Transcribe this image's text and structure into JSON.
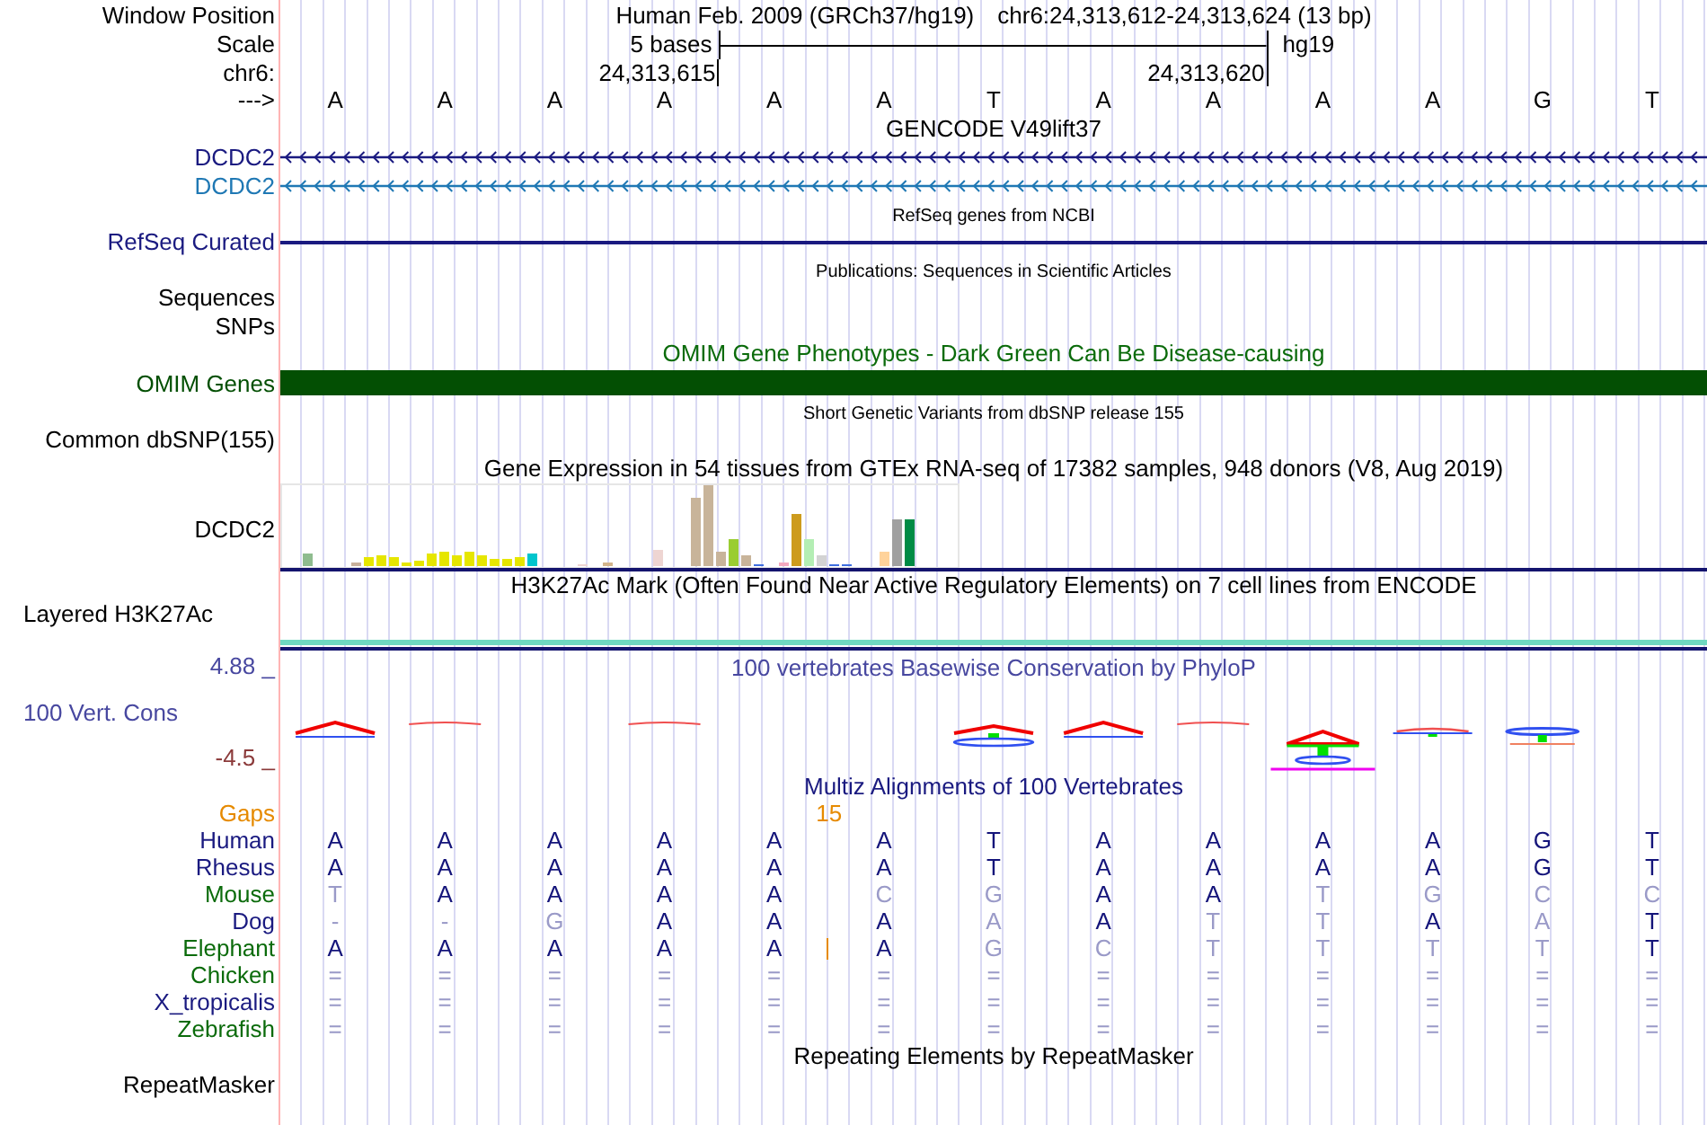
{
  "header": {
    "window_position_label": "Window Position",
    "assembly": "Human Feb. 2009 (GRCh37/hg19)",
    "position": "chr6:24,313,612-24,313,624 (13 bp)",
    "scale_label": "Scale",
    "scale_text": "5 bases",
    "scale_db": "hg19",
    "chrom_label": "chr6:",
    "coord_start": "24,313,615",
    "coord_end": "24,313,620",
    "strand_label": "--->",
    "bases": [
      "A",
      "A",
      "A",
      "A",
      "A",
      "A",
      "T",
      "A",
      "A",
      "A",
      "A",
      "G",
      "T"
    ]
  },
  "tracks": [
    {
      "kind": "title",
      "text": "GENCODE V49lift37"
    },
    {
      "kind": "gene",
      "label": "DCDC2",
      "color": "#1a1a80"
    },
    {
      "kind": "gene",
      "label": "DCDC2",
      "color": "#1f78b4"
    },
    {
      "kind": "note",
      "text": "RefSeq genes from NCBI"
    },
    {
      "kind": "line",
      "label": "RefSeq Curated",
      "color": "#1a1a80"
    },
    {
      "kind": "note",
      "text": "Publications: Sequences in Scientific Articles"
    },
    {
      "kind": "label",
      "label": "Sequences"
    },
    {
      "kind": "label",
      "label": "SNPs"
    },
    {
      "kind": "title",
      "text": "OMIM Gene Phenotypes - Dark Green Can Be Disease-causing",
      "color": "#0b6b0b"
    },
    {
      "kind": "bar",
      "label": "OMIM Genes",
      "color": "#034f03"
    },
    {
      "kind": "note",
      "text": "Short Genetic Variants from dbSNP release 155"
    },
    {
      "kind": "label",
      "label": "Common dbSNP(155)"
    },
    {
      "kind": "title",
      "text": "Gene Expression in 54 tissues from GTEx RNA-seq of 17382 samples, 948 donors (V8, Aug 2019)"
    },
    {
      "kind": "expression",
      "label": "DCDC2"
    },
    {
      "kind": "title",
      "text": "H3K27Ac Mark (Often Found Near Active Regulatory Elements) on 7 cell lines from ENCODE"
    },
    {
      "kind": "layered",
      "label": "Layered H3K27Ac"
    },
    {
      "kind": "conservation",
      "title": "100 vertebrates Basewise Conservation by PhyloP",
      "label": "100 Vert. Cons",
      "max": "4.88 _",
      "min": "-4.5 _"
    },
    {
      "kind": "title",
      "text": "Multiz Alignments of 100 Vertebrates",
      "color": "#1a1a80"
    },
    {
      "kind": "gaps",
      "label": "Gaps",
      "value": "15"
    },
    {
      "kind": "species",
      "label": "Human",
      "color": "#1a1a80",
      "bases": [
        "A",
        "A",
        "A",
        "A",
        "A",
        "A",
        "T",
        "A",
        "A",
        "A",
        "A",
        "G",
        "T"
      ],
      "matches": [
        true,
        true,
        true,
        true,
        true,
        true,
        true,
        true,
        true,
        true,
        true,
        true,
        true
      ]
    },
    {
      "kind": "species",
      "label": "Rhesus",
      "color": "#1a1a80",
      "bases": [
        "A",
        "A",
        "A",
        "A",
        "A",
        "A",
        "T",
        "A",
        "A",
        "A",
        "A",
        "G",
        "T"
      ],
      "matches": [
        true,
        true,
        true,
        true,
        true,
        true,
        true,
        true,
        true,
        true,
        true,
        true,
        true
      ]
    },
    {
      "kind": "species",
      "label": "Mouse",
      "color": "#0b6b0b",
      "bases": [
        "T",
        "A",
        "A",
        "A",
        "A",
        "C",
        "G",
        "A",
        "A",
        "T",
        "G",
        "C",
        "C"
      ],
      "matches": [
        false,
        true,
        true,
        true,
        true,
        false,
        false,
        true,
        true,
        false,
        false,
        false,
        false
      ]
    },
    {
      "kind": "species",
      "label": "Dog",
      "color": "#1a1a80",
      "bases": [
        "-",
        "-",
        "G",
        "A",
        "A",
        "A",
        "A",
        "A",
        "T",
        "T",
        "A",
        "A",
        "T"
      ],
      "matches": [
        false,
        false,
        false,
        true,
        true,
        true,
        false,
        true,
        false,
        false,
        true,
        false,
        true
      ]
    },
    {
      "kind": "species",
      "label": "Elephant",
      "color": "#0b6b0b",
      "insertion": true,
      "bases": [
        "A",
        "A",
        "A",
        "A",
        "A",
        "A",
        "G",
        "C",
        "T",
        "T",
        "T",
        "T",
        "T"
      ],
      "matches": [
        true,
        true,
        true,
        true,
        true,
        true,
        false,
        false,
        false,
        false,
        false,
        false,
        true
      ]
    },
    {
      "kind": "species",
      "label": "Chicken",
      "color": "#0b6b0b",
      "bases": [
        "=",
        "=",
        "=",
        "=",
        "=",
        "=",
        "=",
        "=",
        "=",
        "=",
        "=",
        "=",
        "="
      ],
      "matches": [
        false,
        false,
        false,
        false,
        false,
        false,
        false,
        false,
        false,
        false,
        false,
        false,
        false
      ]
    },
    {
      "kind": "species",
      "label": "X_tropicalis",
      "color": "#1a1a80",
      "bases": [
        "=",
        "=",
        "=",
        "=",
        "=",
        "=",
        "=",
        "=",
        "=",
        "=",
        "=",
        "=",
        "="
      ],
      "matches": [
        false,
        false,
        false,
        false,
        false,
        false,
        false,
        false,
        false,
        false,
        false,
        false,
        false
      ]
    },
    {
      "kind": "species",
      "label": "Zebrafish",
      "color": "#0b6b0b",
      "bases": [
        "=",
        "=",
        "=",
        "=",
        "=",
        "=",
        "=",
        "=",
        "=",
        "=",
        "=",
        "=",
        "="
      ],
      "matches": [
        false,
        false,
        false,
        false,
        false,
        false,
        false,
        false,
        false,
        false,
        false,
        false,
        false
      ]
    },
    {
      "kind": "title",
      "text": "Repeating Elements by RepeatMasker"
    },
    {
      "kind": "label",
      "label": "RepeatMasker"
    }
  ]
}
